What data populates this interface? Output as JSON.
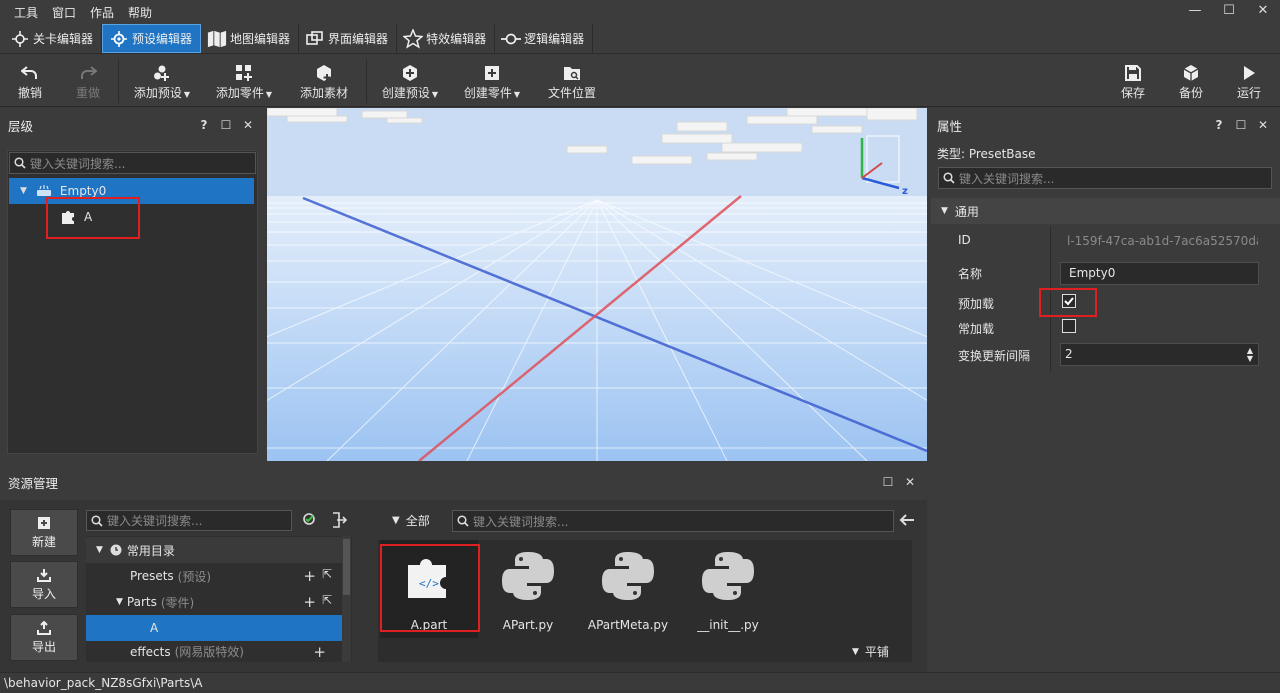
{
  "menu": [
    "工具",
    "窗口",
    "作品",
    "帮助"
  ],
  "window_buttons": [
    "—",
    "☐",
    "✕"
  ],
  "editor_tabs": [
    {
      "label": "关卡编辑器",
      "icon": "level-editor-icon",
      "active": false
    },
    {
      "label": "预设编辑器",
      "icon": "preset-editor-icon",
      "active": true
    },
    {
      "label": "地图编辑器",
      "icon": "map-editor-icon",
      "active": false
    },
    {
      "label": "界面编辑器",
      "icon": "ui-editor-icon",
      "active": false
    },
    {
      "label": "特效编辑器",
      "icon": "effects-editor-icon",
      "active": false
    },
    {
      "label": "逻辑编辑器",
      "icon": "logic-editor-icon",
      "active": false
    }
  ],
  "toolbar": {
    "undo": "撤销",
    "redo": "重做",
    "add_preset": "添加预设",
    "add_part": "添加零件",
    "add_asset": "添加素材",
    "create_preset": "创建预设",
    "create_part": "创建零件",
    "file_location": "文件位置",
    "save": "保存",
    "backup": "备份",
    "run": "运行"
  },
  "hierarchy": {
    "title": "层级",
    "panel_buttons": [
      "?",
      "☐",
      "✕"
    ],
    "search_placeholder": "键入关键词搜索...",
    "root": "Empty0",
    "child": "A"
  },
  "viewport": {
    "gizmo_axis": "z"
  },
  "properties": {
    "title": "属性",
    "panel_buttons": [
      "?",
      "☐",
      "✕"
    ],
    "type_label": "类型: PresetBase",
    "search_placeholder": "键入关键词搜索...",
    "section": "通用",
    "id_label": "ID",
    "id_value": "l-159f-47ca-ab1d-7ac6a52570da",
    "name_label": "名称",
    "name_value": "Empty0",
    "preload_label": "预加载",
    "preload_checked": true,
    "resident_label": "常加载",
    "resident_checked": false,
    "interval_label": "变换更新间隔",
    "interval_value": "2"
  },
  "assets": {
    "title": "资源管理",
    "panel_buttons": [
      "☐",
      "✕"
    ],
    "new": "新建",
    "import": "导入",
    "export": "导出",
    "tree_search_placeholder": "键入关键词搜索...",
    "tree": {
      "common": "常用目录",
      "presets": "Presets",
      "presets_sub": "(预设)",
      "parts": "Parts",
      "parts_sub": "(零件)",
      "part_a": "A",
      "effects": "effects",
      "effects_sub": "(网易版特效)"
    },
    "filter": "全部",
    "grid_search_placeholder": "键入关键词搜索...",
    "files": [
      "A.part",
      "APart.py",
      "APartMeta.py",
      "__init__.py"
    ],
    "layout_mode": "平铺"
  },
  "status_path": "\\behavior_pack_NZ8sGfxi\\Parts\\A"
}
